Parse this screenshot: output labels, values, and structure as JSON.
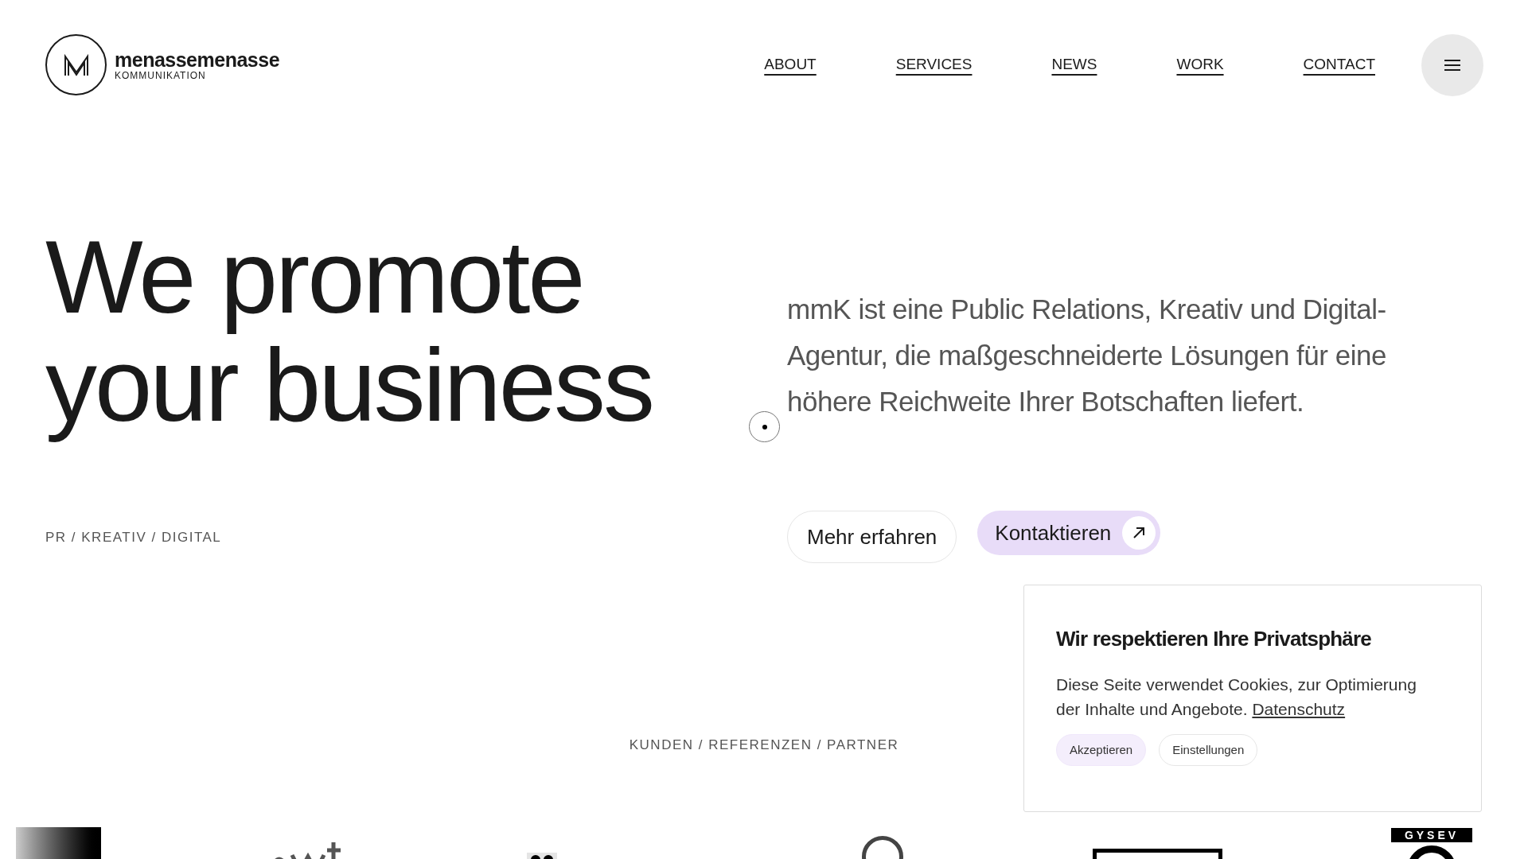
{
  "header": {
    "brand": "menassemenasse",
    "brand_sub": "KOMMUNIKATION",
    "nav": [
      {
        "label": "ABOUT"
      },
      {
        "label": "SERVICES"
      },
      {
        "label": "NEWS"
      },
      {
        "label": "WORK"
      },
      {
        "label": "CONTACT"
      }
    ]
  },
  "hero": {
    "heading_lines": [
      "We promote",
      "your business"
    ],
    "tagline": "PR / KREATIV / DIGITAL",
    "intro": "mmK ist eine Public Relations, Kreativ und Digital-Agentur, die maßgeschneiderte Lösungen für eine höhere Reichweite Ihrer Botschaften liefert.",
    "buttons": [
      {
        "label": "Mehr erfahren",
        "kind": "outline"
      },
      {
        "label": "Kontaktieren",
        "kind": "primary"
      }
    ]
  },
  "clients": {
    "title": "KUNDEN / REFERENZEN / PARTNER",
    "logos": [
      {
        "kind": "gradient"
      },
      {
        "kind": "wordmark"
      },
      {
        "kind": "dots"
      },
      {
        "kind": "emblem"
      },
      {
        "kind": "blackbar"
      },
      {
        "kind": "gysev",
        "text": "GYSEV"
      }
    ]
  },
  "cookie_banner": {
    "title": "Wir respektieren Ihre Privatsphäre",
    "text": "Diese Seite verwendet Cookies, zur Optimierung der Inhalte und Angebote.",
    "link": "Datenschutz",
    "buttons": [
      {
        "label": "Akzeptieren",
        "kind": "primary"
      },
      {
        "label": "Einstellungen",
        "kind": "outline"
      }
    ]
  }
}
